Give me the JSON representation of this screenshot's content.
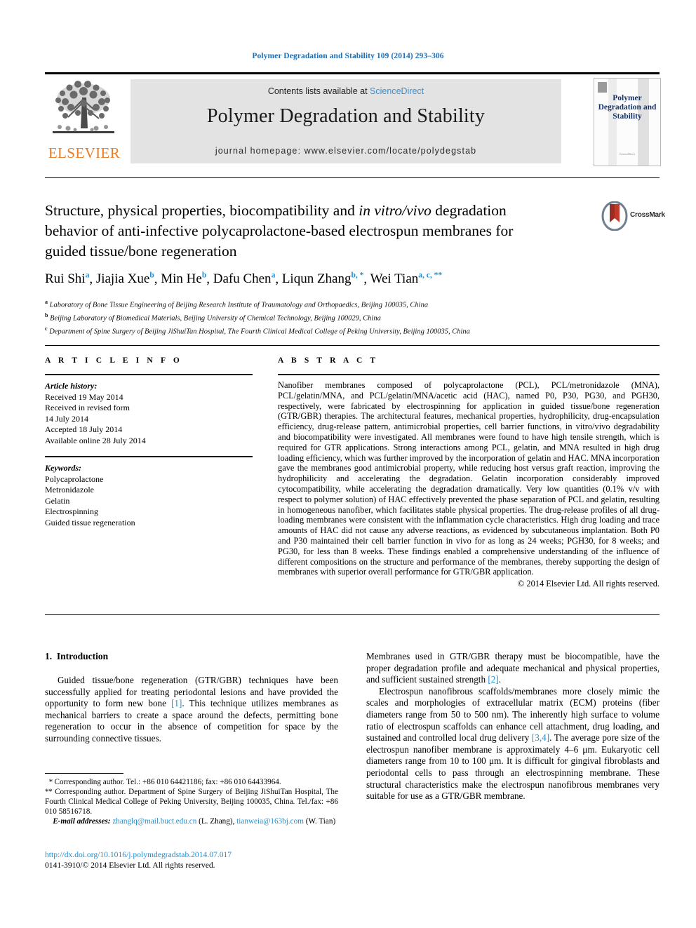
{
  "running_head": "Polymer Degradation and Stability 109 (2014) 293–306",
  "masthead": {
    "contents_prefix": "Contents lists available at ",
    "sciencedirect": "ScienceDirect",
    "journal_title": "Polymer Degradation and Stability",
    "homepage": "journal homepage: www.elsevier.com/locate/polydegstab",
    "elsevier_wordmark": "ELSEVIER",
    "cover_title": "Polymer Degradation and Stability",
    "cover_footer": "ScienceDirect"
  },
  "article": {
    "title": "Structure, physical properties, biocompatibility and in vitro/vivo degradation behavior of anti-infective polycaprolactone-based electrospun membranes for guided tissue/bone regeneration",
    "title_line1_plain": "Structure, physical properties, biocompatibility and ",
    "title_line1_italic": "in vitro/vivo",
    "title_rest": " degradation behavior of anti-infective polycaprolactone-based electrospun membranes for guided tissue/bone regeneration",
    "crossmark_label": "CrossMark",
    "authors": [
      {
        "name": "Rui Shi",
        "marks": "a"
      },
      {
        "name": "Jiajia Xue",
        "marks": "b"
      },
      {
        "name": "Min He",
        "marks": "b"
      },
      {
        "name": "Dafu Chen",
        "marks": "a"
      },
      {
        "name": "Liqun Zhang",
        "marks": "b, *"
      },
      {
        "name": "Wei Tian",
        "marks": "a, c, **"
      }
    ],
    "affiliations": [
      {
        "mark": "a",
        "text": "Laboratory of Bone Tissue Engineering of Beijing Research Institute of Traumatology and Orthopaedics, Beijing 100035, China"
      },
      {
        "mark": "b",
        "text": "Beijing Laboratory of Biomedical Materials, Beijing University of Chemical Technology, Beijing 100029, China"
      },
      {
        "mark": "c",
        "text": "Department of Spine Surgery of Beijing JiShuiTan Hospital, The Fourth Clinical Medical College of Peking University, Beijing 100035, China"
      }
    ]
  },
  "article_info": {
    "heading": "A R T I C L E   I N F O",
    "history_label": "Article history:",
    "history": [
      "Received 19 May 2014",
      "Received in revised form",
      "14 July 2014",
      "Accepted 18 July 2014",
      "Available online 28 July 2014"
    ],
    "keywords_label": "Keywords:",
    "keywords": [
      "Polycaprolactone",
      "Metronidazole",
      "Gelatin",
      "Electrospinning",
      "Guided tissue regeneration"
    ]
  },
  "abstract": {
    "heading": "A B S T R A C T",
    "text": "Nanofiber membranes composed of polycaprolactone (PCL), PCL/metronidazole (MNA), PCL/gelatin/MNA, and PCL/gelatin/MNA/acetic acid (HAC), named P0, P30, PG30, and PGH30, respectively, were fabricated by electrospinning for application in guided tissue/bone regeneration (GTR/GBR) therapies. The architectural features, mechanical properties, hydrophilicity, drug-encapsulation efficiency, drug-release pattern, antimicrobial properties, cell barrier functions, in vitro/vivo degradability and biocompatibility were investigated. All membranes were found to have high tensile strength, which is required for GTR applications. Strong interactions among PCL, gelatin, and MNA resulted in high drug loading efficiency, which was further improved by the incorporation of gelatin and HAC. MNA incorporation gave the membranes good antimicrobial property, while reducing host versus graft reaction, improving the hydrophilicity and accelerating the degradation. Gelatin incorporation considerably improved cytocompatibility, while accelerating the degradation dramatically. Very low quantities (0.1% v/v with respect to polymer solution) of HAC effectively prevented the phase separation of PCL and gelatin, resulting in homogeneous nanofiber, which facilitates stable physical properties. The drug-release profiles of all drug-loading membranes were consistent with the inflammation cycle characteristics. High drug loading and trace amounts of HAC did not cause any adverse reactions, as evidenced by subcutaneous implantation. Both P0 and P30 maintained their cell barrier function in vivo for as long as 24 weeks; PGH30, for 8 weeks; and PG30, for less than 8 weeks. These findings enabled a comprehensive understanding of the influence of different compositions on the structure and performance of the membranes, thereby supporting the design of membranes with superior overall performance for GTR/GBR application.",
    "copyright": "© 2014 Elsevier Ltd. All rights reserved."
  },
  "introduction": {
    "section_number": "1.",
    "section_title": "Introduction",
    "left_paragraphs": [
      "Guided tissue/bone regeneration (GTR/GBR) techniques have been successfully applied for treating periodontal lesions and have provided the opportunity to form new bone [1]. This technique utilizes membranes as mechanical barriers to create a space around the defects, permitting bone regeneration to occur in the absence of competition for space by the surrounding connective tissues."
    ],
    "right_paragraphs": [
      "Membranes used in GTR/GBR therapy must be biocompatible, have the proper degradation profile and adequate mechanical and physical properties, and sufficient sustained strength [2].",
      "Electrospun nanofibrous scaffolds/membranes more closely mimic the scales and morphologies of extracellular matrix (ECM) proteins (fiber diameters range from 50 to 500 nm). The inherently high surface to volume ratio of electrospun scaffolds can enhance cell attachment, drug loading, and sustained and controlled local drug delivery [3,4]. The average pore size of the electrospun nanofiber membrane is approximately 4–6 μm. Eukaryotic cell diameters range from 10 to 100 μm. It is difficult for gingival fibroblasts and periodontal cells to pass through an electrospinning membrane. These structural characteristics make the electrospun nanofibrous membranes very suitable for use as a GTR/GBR membrane."
    ]
  },
  "footnotes": {
    "corresponding_1": "Corresponding author. Tel.: +86 010 64421186; fax: +86 010 64433964.",
    "corresponding_2": "Corresponding author. Department of Spine Surgery of Beijing JiShuiTan Hospital, The Fourth Clinical Medical College of Peking University, Beijing 100035, China. Tel./fax: +86 010 58516718.",
    "email_label": "E-mail addresses:",
    "emails": [
      {
        "address": "zhanglq@mail.buct.edu.cn",
        "owner": "(L. Zhang)"
      },
      {
        "address": "tianweia@163bj.com",
        "owner": "(W. Tian)"
      }
    ]
  },
  "footer": {
    "doi": "http://dx.doi.org/10.1016/j.polymdegradstab.2014.07.017",
    "issn_line": "0141-3910/© 2014 Elsevier Ltd. All rights reserved."
  },
  "colors": {
    "link_blue": "#1f8fd0",
    "header_blue": "#1f6fb5",
    "elsevier_orange": "#eb7c22",
    "band_gray": "#e3e3e3",
    "cover_navy": "#15336b"
  }
}
